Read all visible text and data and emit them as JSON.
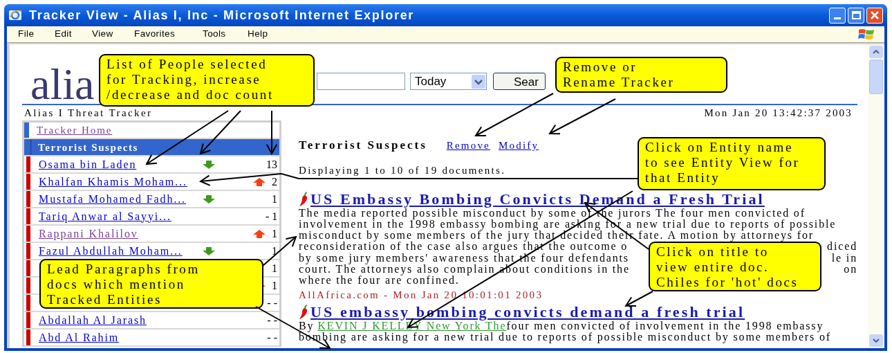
{
  "window": {
    "title": "Tracker View - Alias I, Inc - Microsoft Internet Explorer"
  },
  "menu": [
    "File",
    "Edit",
    "View",
    "Favorites",
    "Tools",
    "Help"
  ],
  "page": {
    "logo": "alia",
    "search": {
      "date_range": "Today",
      "button": "Sear"
    },
    "subtitle": "Alias I Threat Tracker",
    "date": "Mon Jan 20 13:42:37 2003"
  },
  "sidebar": {
    "items": [
      {
        "kind": "link",
        "label": "Tracker Home",
        "visited": true,
        "selected": false
      },
      {
        "kind": "tracker",
        "label": "Terrorist Suspects",
        "selected": true
      },
      {
        "kind": "person",
        "name": "Osama bin Laden",
        "visited": false,
        "increase": false,
        "decrease": true,
        "count": "13",
        "selected": false
      },
      {
        "kind": "person",
        "name": "Khalfan Khamis Moham...",
        "visited": false,
        "increase": true,
        "decrease": false,
        "count": "2",
        "selected": false
      },
      {
        "kind": "person",
        "name": "Mustafa Mohamed Fadh...",
        "visited": false,
        "increase": false,
        "decrease": true,
        "count": "1",
        "selected": false
      },
      {
        "kind": "person",
        "name": "Tariq Anwar al Sayyi...",
        "visited": false,
        "increase": false,
        "decrease": false,
        "count": "- 1",
        "selected": false
      },
      {
        "kind": "person",
        "name": "Rappani Khalilov",
        "visited": true,
        "increase": true,
        "decrease": false,
        "count": "1",
        "selected": false
      },
      {
        "kind": "person",
        "name": "Fazul Abdullah Moham...",
        "visited": false,
        "increase": false,
        "decrease": true,
        "count": "1",
        "selected": false
      },
      {
        "kind": "person",
        "increase": false,
        "decrease": false,
        "count": "1",
        "selected": false
      },
      {
        "kind": "person",
        "increase": true,
        "decrease": false,
        "count": "1",
        "selected": false
      },
      {
        "kind": "person",
        "increase": false,
        "decrease": false,
        "count": "- -",
        "selected": false
      },
      {
        "kind": "person",
        "name": "Abdallah Al Jarash",
        "visited": false,
        "increase": false,
        "decrease": false,
        "count": "- -",
        "selected": false
      },
      {
        "kind": "person",
        "name": "Abd Al Rahim",
        "visited": false,
        "increase": false,
        "decrease": false,
        "count": "- -",
        "selected": false
      }
    ]
  },
  "main": {
    "heading": "Terrorist Suspects",
    "actions": [
      "Remove",
      "Modify"
    ],
    "summary": "Displaying 1 to 10 of 19 documents.",
    "documents": [
      {
        "hot": true,
        "title": "US Embassy Bombing Convicts Demand a Fresh Trial",
        "lines": [
          [
            "The media reported possible misconduct by some of the jurors The four men convicted of"
          ],
          [
            "involvement in the 1998 embassy bombing are asking for a new trial due to reports of possible"
          ],
          [
            "misconduct by some members of the jury that decided their fate. A motion by attorneys for"
          ],
          [
            "reconsideration of the case also argues that the outcome o",
            "diced"
          ],
          [
            "by some jury members' awareness that the four defendants",
            "le in"
          ],
          [
            "court. The attorneys also complain about conditions in the",
            "on"
          ],
          [
            "where the four are confined."
          ]
        ],
        "source": "AllAfrica.com - Mon Jan 20 10:01:01 2003"
      },
      {
        "hot": true,
        "title": "US embassy bombing convicts demand a fresh trial",
        "byline": {
          "prefix": "By",
          "author": "KEVIN J KELLEY New York The",
          "rest": "four men convicted of involvement in the 1998 embassy"
        },
        "lines": [
          [
            "bombing are asking for a new trial due to reports of possible misconduct by some members of"
          ]
        ]
      }
    ]
  },
  "callouts": [
    {
      "text": "List of People selected\nfor Tracking, increase\n/decrease and doc count"
    },
    {
      "text": "Remove or\nRename Tracker"
    },
    {
      "text": "Click on Entity name\nto see Entity View for\nthat Entity"
    },
    {
      "text": "Lead Paragraphs from\ndocs which mention\nTracked Entities"
    },
    {
      "text": "Click on title to\nview entire doc.\nChiles for 'hot' docs"
    }
  ]
}
